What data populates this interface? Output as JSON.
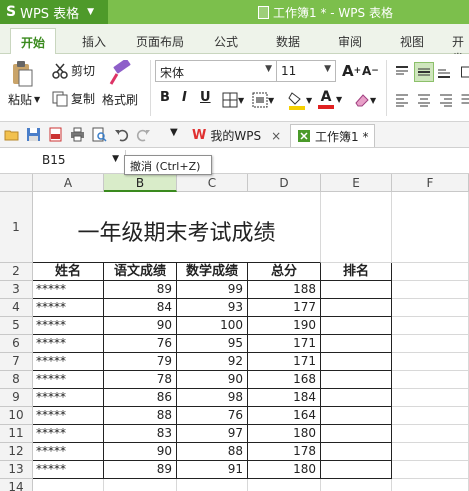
{
  "app": {
    "logo": "S",
    "name": "WPS 表格",
    "title": "工作簿1 * - WPS 表格"
  },
  "tabs": [
    "开始",
    "插入",
    "页面布局",
    "公式",
    "数据",
    "审阅",
    "视图",
    "开发"
  ],
  "ribbon": {
    "paste": "粘贴",
    "cut": "剪切",
    "copy": "复制",
    "format_painter": "格式刷",
    "font_name": "宋体",
    "font_size": "11",
    "bold": "B",
    "italic": "I",
    "underline": "U"
  },
  "quick_access": {
    "doc_tab_1": "我的WPS",
    "doc_tab_2": "工作簿1 *"
  },
  "formula_bar": {
    "name_box": "B15",
    "tooltip": "撤消 (Ctrl+Z)"
  },
  "columns": [
    "A",
    "B",
    "C",
    "D",
    "E",
    "F"
  ],
  "rows": [
    "1",
    "2",
    "3",
    "4",
    "5",
    "6",
    "7",
    "8",
    "9",
    "10",
    "11",
    "12",
    "13",
    "14"
  ],
  "sheet": {
    "title": "一年级期末考试成绩",
    "headers": [
      "姓名",
      "语文成绩",
      "数学成绩",
      "总分",
      "排名"
    ],
    "data": [
      [
        "*****",
        "89",
        "99",
        "188"
      ],
      [
        "*****",
        "84",
        "93",
        "177"
      ],
      [
        "*****",
        "90",
        "100",
        "190"
      ],
      [
        "*****",
        "76",
        "95",
        "171"
      ],
      [
        "*****",
        "79",
        "92",
        "171"
      ],
      [
        "*****",
        "78",
        "90",
        "168"
      ],
      [
        "*****",
        "86",
        "98",
        "184"
      ],
      [
        "*****",
        "88",
        "76",
        "164"
      ],
      [
        "*****",
        "83",
        "97",
        "180"
      ],
      [
        "*****",
        "90",
        "88",
        "178"
      ],
      [
        "*****",
        "89",
        "91",
        "180"
      ]
    ]
  },
  "colors": {
    "accent": "#3a8a1e",
    "titlebar": "#7cbf4c",
    "app_button": "#4e9a2a"
  }
}
